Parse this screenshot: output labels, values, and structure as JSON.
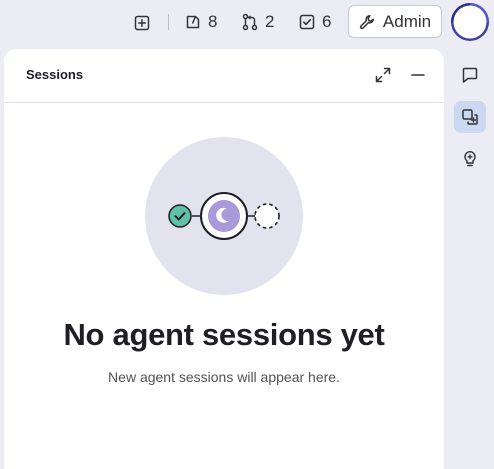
{
  "topbar": {
    "new_item_icon": "plus-square-icon",
    "issues": {
      "icon": "issues-icon",
      "count": "8"
    },
    "merge_requests": {
      "icon": "merge-request-icon",
      "count": "2"
    },
    "todos": {
      "icon": "todo-check-icon",
      "count": "6"
    },
    "admin": {
      "icon": "wrench-icon",
      "label": "Admin"
    },
    "avatar_icon": "avatar"
  },
  "panel": {
    "title": "Sessions",
    "expand_icon": "expand-icon",
    "minimize_icon": "minimize-icon",
    "empty_state": {
      "title": "No agent sessions yet",
      "subtitle": "New agent sessions will appear here."
    }
  },
  "rail": {
    "items": [
      {
        "icon": "chat-icon",
        "active": false
      },
      {
        "icon": "sessions-icon",
        "active": true
      },
      {
        "icon": "lightbulb-icon",
        "active": false
      }
    ]
  },
  "colors": {
    "background": "#ececf4",
    "panel": "#ffffff",
    "illustration_circle": "#e3e2ef",
    "success": "#5fc2a6",
    "agent_purple": "#a99bd9",
    "active_rail": "#cbd9f0"
  }
}
